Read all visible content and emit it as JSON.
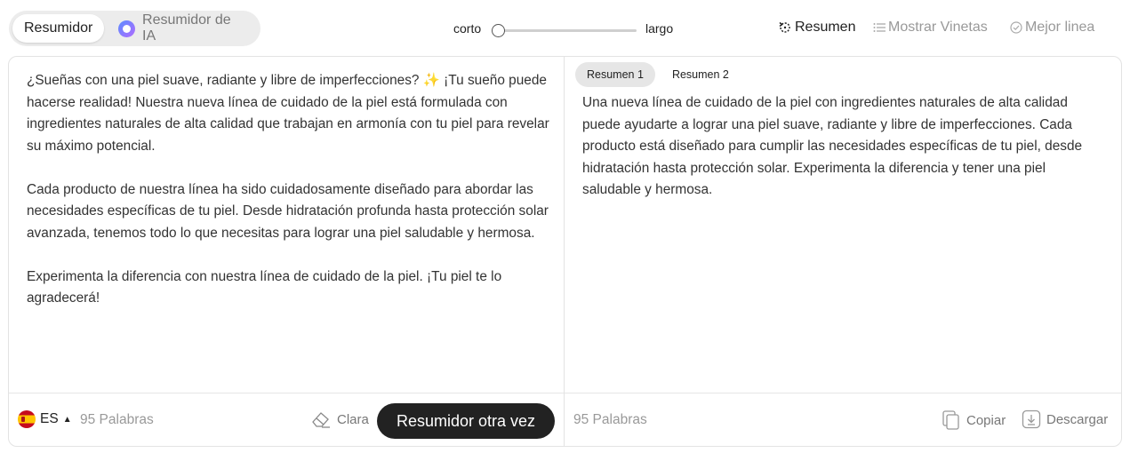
{
  "mode_switch": {
    "tab_summarizer": "Resumidor",
    "tab_ai": "Resumidor de IA"
  },
  "length": {
    "short_label": "corto",
    "long_label": "largo",
    "value": 0
  },
  "top_actions": {
    "summary": "Resumen",
    "bullets": "Mostrar Vinetas",
    "best_line": "Mejor linea"
  },
  "input": {
    "text": "¿Sueñas con una piel suave, radiante y libre de imperfecciones? ✨ ¡Tu sueño puede hacerse realidad! Nuestra nueva línea de cuidado de la piel está formulada con ingredientes naturales de alta calidad que trabajan en armonía con tu piel para revelar su máximo potencial.\n\nCada producto de nuestra línea ha sido cuidadosamente diseñado para abordar las necesidades específicas de tu piel. Desde hidratación profunda hasta protección solar avanzada, tenemos todo lo que necesitas para lograr una piel saludable y hermosa.\n\nExperimenta la diferencia con nuestra línea de cuidado de la piel. ¡Tu piel te lo agradecerá!",
    "language": "ES",
    "word_count": "95 Palabras",
    "clear_label": "Clara",
    "run_label": "Resumidor otra vez"
  },
  "output": {
    "tabs": [
      "Resumen 1",
      "Resumen 2"
    ],
    "text": "Una nueva línea de cuidado de la piel con ingredientes naturales de alta calidad puede ayudarte a lograr una piel suave, radiante y libre de imperfecciones. Cada producto está diseñado para cumplir las necesidades específicas de tu piel, desde hidratación hasta protección solar. Experimenta la diferencia y tener una piel saludable y hermosa.",
    "word_count": "95 Palabras",
    "copy_label": "Copiar",
    "download_label": "Descargar"
  }
}
